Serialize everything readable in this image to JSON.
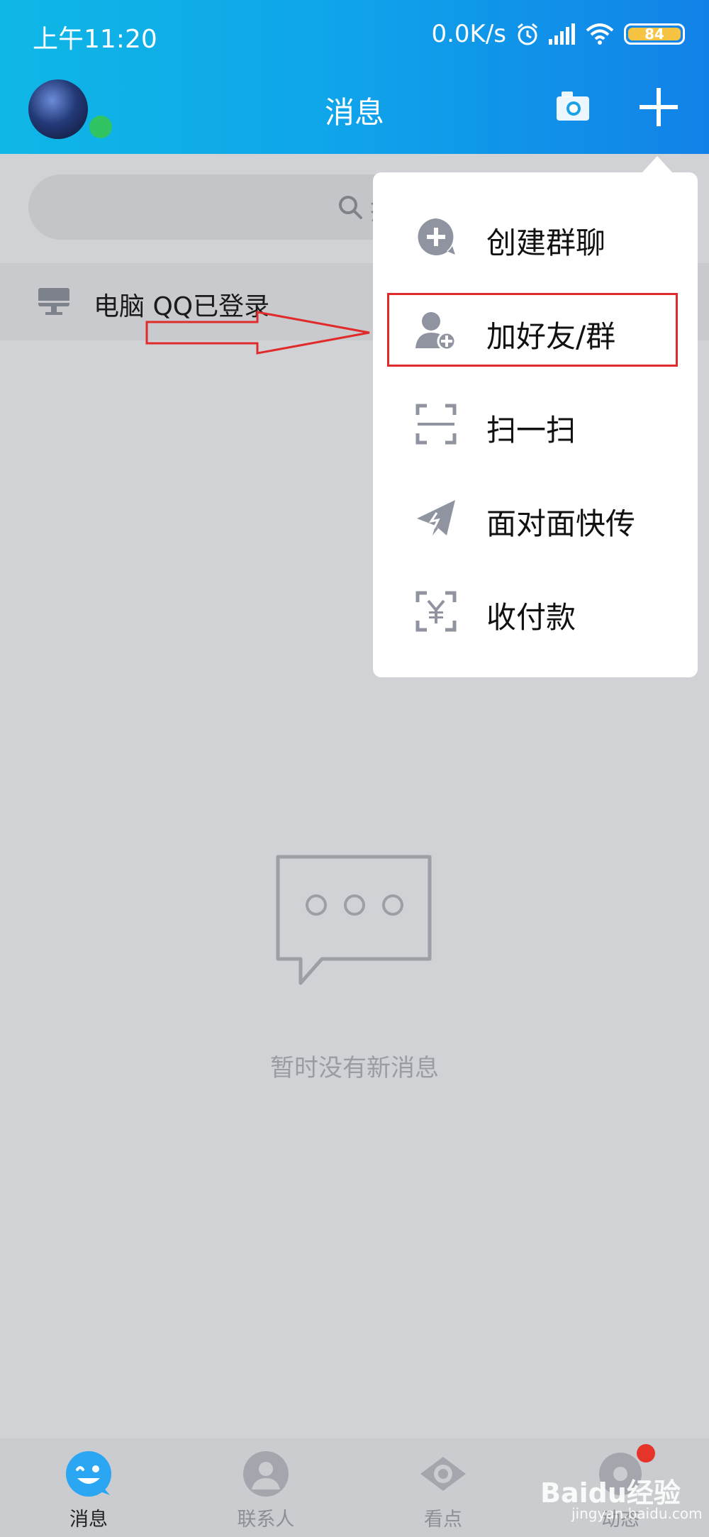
{
  "status_bar": {
    "time": "上午11:20",
    "net_speed": "0.0K/s",
    "battery": "84",
    "icons": [
      "alarm-icon",
      "signal-icon",
      "wifi-icon",
      "battery-icon"
    ]
  },
  "header": {
    "title": "消息",
    "icons": [
      "avatar",
      "camera-icon",
      "plus-icon"
    ]
  },
  "search": {
    "placeholder": "搜"
  },
  "pc_login": {
    "text": "电脑 QQ已登录"
  },
  "menu": {
    "items": [
      {
        "label": "创建群聊",
        "icon": "create-group-icon"
      },
      {
        "label": "加好友/群",
        "icon": "add-friend-icon",
        "highlighted": true
      },
      {
        "label": "扫一扫",
        "icon": "scan-icon"
      },
      {
        "label": "面对面快传",
        "icon": "send-icon"
      },
      {
        "label": "收付款",
        "icon": "payment-icon"
      }
    ]
  },
  "empty_state": {
    "text": "暂时没有新消息"
  },
  "tabs": [
    {
      "label": "消息",
      "icon": "messages-icon",
      "active": true
    },
    {
      "label": "联系人",
      "icon": "contacts-icon",
      "active": false
    },
    {
      "label": "看点",
      "icon": "eye-icon",
      "active": false
    },
    {
      "label": "动态",
      "icon": "dynamic-icon",
      "active": false
    }
  ],
  "watermark": {
    "text": "Baidu经验",
    "sub": "jingyan.baidu.com"
  },
  "colors": {
    "header_start": "#0fb7e6",
    "header_end": "#1282e8",
    "annotation_red": "#e12b2b",
    "online_green": "#30c562",
    "badge_red": "#e5352b"
  }
}
